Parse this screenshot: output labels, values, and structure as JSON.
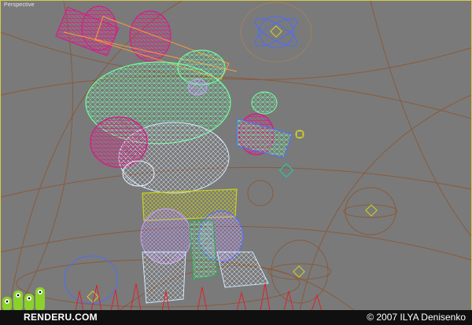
{
  "viewport": {
    "label": "Perspective"
  },
  "footer": {
    "brand": "RENDERU.COM",
    "copyright": "© 2007 ILYA Denisenko"
  },
  "colors": {
    "viewport_bg": "#7a7a7a",
    "viewport_border": "#d9c94a",
    "footer_bg": "#101010",
    "logo_green": "#8ad12c",
    "wire_green": "#6dff9a",
    "wire_magenta": "#d0208a",
    "wire_orange": "#ff9a3c",
    "wire_blue": "#4a6dff",
    "wire_yellow": "#d4d420",
    "spline_brown": "#8a5a3a"
  }
}
